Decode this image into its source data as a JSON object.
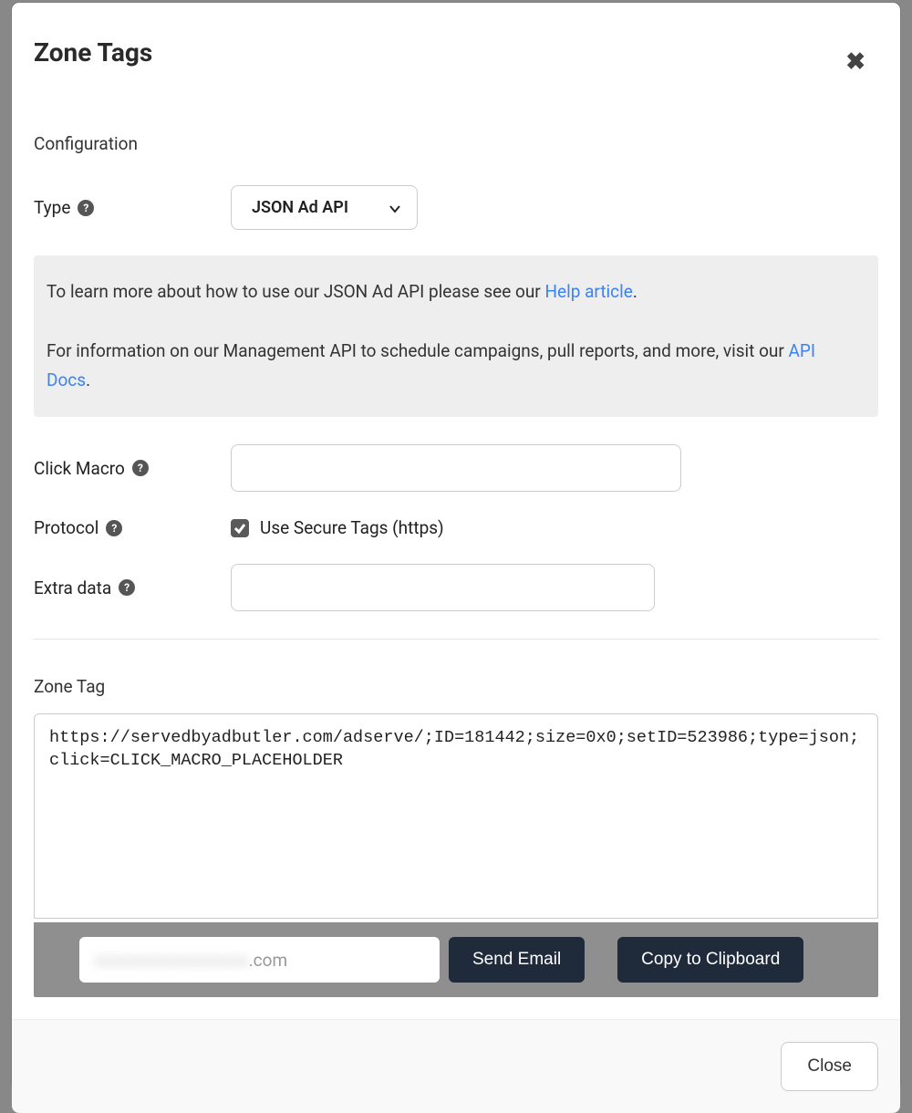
{
  "modal": {
    "title": "Zone Tags",
    "section_label": "Configuration",
    "type_label": "Type",
    "type_select_value": "JSON Ad API",
    "info": {
      "line1_prefix": "To learn more about how to use our JSON Ad API please see our ",
      "help_link": "Help article",
      "line1_suffix": ".",
      "line2_prefix": "For information on our Management API to schedule campaigns, pull reports, and more, visit our ",
      "api_link": "API Docs",
      "line2_suffix": "."
    },
    "click_macro_label": "Click Macro",
    "click_macro_value": "",
    "protocol_label": "Protocol",
    "protocol_checkbox_label": "Use Secure Tags (https)",
    "protocol_checked": true,
    "extra_data_label": "Extra data",
    "extra_data_value": "",
    "zone_tag_label": "Zone Tag",
    "zone_tag_value": "https://servedbyadbutler.com/adserve/;ID=181442;size=0x0;setID=523986;type=json;click=CLICK_MACRO_PLACEHOLDER",
    "email_value_suffix": ".com",
    "send_email_button": "Send Email",
    "copy_button": "Copy to Clipboard",
    "close_button": "Close"
  }
}
